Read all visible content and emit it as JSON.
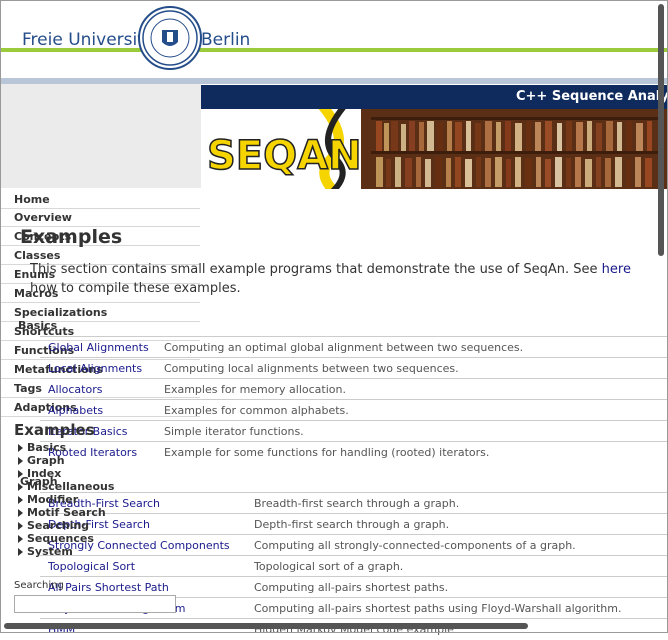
{
  "header": {
    "university_left": "Freie Universität",
    "university_right": "Berlin",
    "seal_text": "VERITAS IUSTITIA LIBERTAS"
  },
  "banner": {
    "top_text": "C++ Sequence Analys",
    "logo_text": "SEQAN"
  },
  "nav": {
    "items": [
      "Home",
      "Overview",
      "Concepts",
      "Classes",
      "Enums",
      "Macros",
      "Specializations",
      "Shortcuts",
      "Functions",
      "Metafunctions",
      "Tags",
      "Adaptions"
    ]
  },
  "sidebar": {
    "examples_heading": "Examples",
    "tree": [
      "Basics",
      "Graph",
      "Index",
      "Miscellaneous",
      "Modifier",
      "Motif Search",
      "Searching",
      "Sequences",
      "System"
    ],
    "search_label": "Searching"
  },
  "main": {
    "title": "Examples",
    "intro_line1": "This section contains small example programs that demonstrate the use of SeqAn. See ",
    "intro_link": "here",
    "intro_line2": "how to compile these examples.",
    "basics": {
      "title": "Basics",
      "rows": [
        {
          "name": "Global Alignments",
          "desc": "Computing an optimal global alignment between two sequences."
        },
        {
          "name": "Local Alignments",
          "desc": "Computing local alignments between two sequences."
        },
        {
          "name": "Allocators",
          "desc": "Examples for memory allocation."
        },
        {
          "name": "Alphabets",
          "desc": "Examples for common alphabets."
        },
        {
          "name": "Iterator Basics",
          "desc": "Simple iterator functions."
        },
        {
          "name": "Rooted Iterators",
          "desc": "Example for some functions for handling (rooted) iterators."
        }
      ]
    },
    "graph": {
      "title": "Graph",
      "rows": [
        {
          "name": "Breadth-First Search",
          "desc": "Breadth-first search through a graph."
        },
        {
          "name": "Depth-First Search",
          "desc": "Depth-first search through a graph."
        },
        {
          "name": "Strongly Connected Components",
          "desc": "Computing all strongly-connected-components of a graph."
        },
        {
          "name": "Topological Sort",
          "desc": "Topological sort of a graph."
        },
        {
          "name": "All Pairs Shortest Path",
          "desc": "Computing all-pairs shortest paths."
        },
        {
          "name": "Floyd-Warshall Algorithm",
          "desc": "Computing all-pairs shortest paths using Floyd-Warshall algorithm."
        },
        {
          "name": "HMM",
          "desc": "Hidden Markov Model code example"
        }
      ]
    }
  },
  "colors": {
    "fu_blue": "#244d8a",
    "fu_green": "#9acb3c",
    "banner_bar": "#0f2b5e",
    "link": "#1a1a8c",
    "logo_yellow": "#f5d400"
  }
}
